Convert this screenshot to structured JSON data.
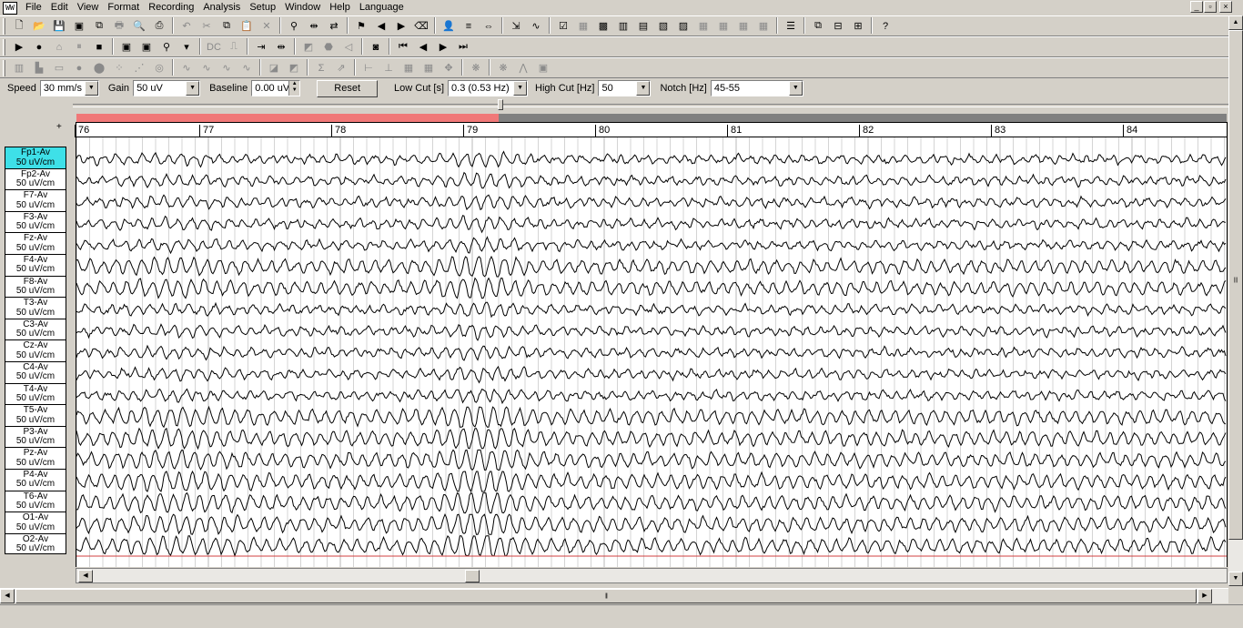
{
  "menu": [
    "File",
    "Edit",
    "View",
    "Format",
    "Recording",
    "Analysis",
    "Setup",
    "Window",
    "Help",
    "Language"
  ],
  "app_icon_text": "WW",
  "window_controls": [
    "_",
    "▫",
    "×"
  ],
  "toolbar1": [
    {
      "icon": "new-file-icon",
      "glyph": "🗋",
      "dim": false
    },
    {
      "icon": "open-folder-icon",
      "glyph": "📂",
      "dim": false
    },
    {
      "icon": "save-icon",
      "glyph": "💾",
      "dim": false
    },
    {
      "icon": "save-as-icon",
      "glyph": "▣",
      "dim": false
    },
    {
      "icon": "copy-icon",
      "glyph": "⧉",
      "dim": false
    },
    {
      "icon": "print-icon",
      "glyph": "🖶",
      "dim": true
    },
    {
      "icon": "print-preview-icon",
      "glyph": "🔍",
      "dim": true
    },
    {
      "icon": "print-setup-icon",
      "glyph": "⎙",
      "dim": false
    },
    {
      "icon": "undo-icon",
      "glyph": "↶",
      "dim": true
    },
    {
      "icon": "cut-icon",
      "glyph": "✂",
      "dim": true
    },
    {
      "icon": "copy2-icon",
      "glyph": "⧉",
      "dim": false
    },
    {
      "icon": "paste-icon",
      "glyph": "📋",
      "dim": false
    },
    {
      "icon": "delete-icon",
      "glyph": "✕",
      "dim": true
    },
    {
      "icon": "find-icon",
      "glyph": "⚲",
      "dim": false
    },
    {
      "icon": "split-icon",
      "glyph": "⇹",
      "dim": false
    },
    {
      "icon": "replace-icon",
      "glyph": "⇄",
      "dim": false
    },
    {
      "icon": "marker-icon",
      "glyph": "⚑",
      "dim": false
    },
    {
      "icon": "marker-prev-icon",
      "glyph": "◀",
      "dim": false
    },
    {
      "icon": "marker-next-icon",
      "glyph": "▶",
      "dim": false
    },
    {
      "icon": "marker-delete-icon",
      "glyph": "⌫",
      "dim": false
    },
    {
      "icon": "patient-icon",
      "glyph": "👤",
      "dim": false
    },
    {
      "icon": "montage-icon",
      "glyph": "≡",
      "dim": false
    },
    {
      "icon": "fit-icon",
      "glyph": "⇔",
      "dim": false
    },
    {
      "icon": "compress-icon",
      "glyph": "⇲",
      "dim": false
    },
    {
      "icon": "filter-icon",
      "glyph": "∿",
      "dim": false
    },
    {
      "icon": "check-icon",
      "glyph": "☑",
      "dim": false
    },
    {
      "icon": "map1-icon",
      "glyph": "▦",
      "dim": true
    },
    {
      "icon": "map2-icon",
      "glyph": "▩",
      "dim": false
    },
    {
      "icon": "map3-icon",
      "glyph": "▥",
      "dim": false
    },
    {
      "icon": "map4-icon",
      "glyph": "▤",
      "dim": false
    },
    {
      "icon": "map5-icon",
      "glyph": "▧",
      "dim": false
    },
    {
      "icon": "map6-icon",
      "glyph": "▨",
      "dim": false
    },
    {
      "icon": "map7-icon",
      "glyph": "▦",
      "dim": true
    },
    {
      "icon": "map8-icon",
      "glyph": "▦",
      "dim": true
    },
    {
      "icon": "map9-icon",
      "glyph": "▦",
      "dim": true
    },
    {
      "icon": "map10-icon",
      "glyph": "▦",
      "dim": true
    },
    {
      "icon": "list-icon",
      "glyph": "☰",
      "dim": false
    },
    {
      "icon": "cascade-icon",
      "glyph": "⧉",
      "dim": false
    },
    {
      "icon": "tile-h-icon",
      "glyph": "⊟",
      "dim": false
    },
    {
      "icon": "tile-v-icon",
      "glyph": "⊞",
      "dim": false
    },
    {
      "icon": "help-icon",
      "glyph": "?",
      "dim": false
    }
  ],
  "toolbar2": [
    {
      "icon": "play-icon",
      "glyph": "▶",
      "dim": false
    },
    {
      "icon": "record-icon",
      "glyph": "●",
      "dim": false
    },
    {
      "icon": "camera-icon",
      "glyph": "⌂",
      "dim": true
    },
    {
      "icon": "pause-icon",
      "glyph": "⏸",
      "dim": true
    },
    {
      "icon": "stop-icon",
      "glyph": "■",
      "dim": false
    },
    {
      "icon": "photo-icon",
      "glyph": "▣",
      "dim": false
    },
    {
      "icon": "photo2-icon",
      "glyph": "▣",
      "dim": false
    },
    {
      "icon": "zoom-icon",
      "glyph": "⚲",
      "dim": false
    },
    {
      "icon": "zoom-dropdown-icon",
      "glyph": "▾",
      "dim": false
    },
    {
      "icon": "dc-icon",
      "glyph": "DC",
      "dim": true
    },
    {
      "icon": "calibrate-icon",
      "glyph": "⎍",
      "dim": true
    },
    {
      "icon": "stim-icon",
      "glyph": "⇥",
      "dim": false
    },
    {
      "icon": "stim2-icon",
      "glyph": "⇹",
      "dim": false
    },
    {
      "icon": "photic-icon",
      "glyph": "◩",
      "dim": true
    },
    {
      "icon": "hyperv-icon",
      "glyph": "⬣",
      "dim": true
    },
    {
      "icon": "sound-icon",
      "glyph": "◁",
      "dim": true
    },
    {
      "icon": "video-icon",
      "glyph": "◙",
      "dim": false
    },
    {
      "icon": "rewind-icon",
      "glyph": "⏮",
      "dim": false
    },
    {
      "icon": "back-icon",
      "glyph": "◀",
      "dim": false
    },
    {
      "icon": "forward-icon",
      "glyph": "▶",
      "dim": false
    },
    {
      "icon": "fast-forward-icon",
      "glyph": "⏭",
      "dim": false
    }
  ],
  "toolbar3": [
    {
      "icon": "bars-icon",
      "glyph": "▥",
      "dim": true
    },
    {
      "icon": "stat-icon",
      "glyph": "▙",
      "dim": true
    },
    {
      "icon": "rect-icon",
      "glyph": "▭",
      "dim": true
    },
    {
      "icon": "circle-icon",
      "glyph": "●",
      "dim": true
    },
    {
      "icon": "blob-icon",
      "glyph": "⬤",
      "dim": true
    },
    {
      "icon": "dots-icon",
      "glyph": "⁘",
      "dim": true
    },
    {
      "icon": "scatter-icon",
      "glyph": "⋰",
      "dim": true
    },
    {
      "icon": "target-icon",
      "glyph": "◎",
      "dim": true
    },
    {
      "icon": "wave1-icon",
      "glyph": "∿",
      "dim": true
    },
    {
      "icon": "wave2-icon",
      "glyph": "∿",
      "dim": true
    },
    {
      "icon": "wave3-icon",
      "glyph": "∿",
      "dim": true
    },
    {
      "icon": "wave4-icon",
      "glyph": "∿",
      "dim": true
    },
    {
      "icon": "slash-box-icon",
      "glyph": "◪",
      "dim": true
    },
    {
      "icon": "slash-box2-icon",
      "glyph": "◩",
      "dim": true
    },
    {
      "icon": "sigma-icon",
      "glyph": "Σ",
      "dim": true
    },
    {
      "icon": "chart-icon",
      "glyph": "⇗",
      "dim": true
    },
    {
      "icon": "cursor-h-icon",
      "glyph": "⊢",
      "dim": true
    },
    {
      "icon": "cursor-v-icon",
      "glyph": "⊥",
      "dim": true
    },
    {
      "icon": "grid1-icon",
      "glyph": "▦",
      "dim": true
    },
    {
      "icon": "grid2-icon",
      "glyph": "▦",
      "dim": true
    },
    {
      "icon": "move-icon",
      "glyph": "✥",
      "dim": true
    },
    {
      "icon": "brain-icon",
      "glyph": "❋",
      "dim": true
    },
    {
      "icon": "brain2-icon",
      "glyph": "❋",
      "dim": true
    },
    {
      "icon": "spike-icon",
      "glyph": "⋀",
      "dim": true
    },
    {
      "icon": "export-icon",
      "glyph": "▣",
      "dim": true
    }
  ],
  "settings": {
    "speed_label": "Speed",
    "speed_value": "30 mm/s",
    "gain_label": "Gain",
    "gain_value": "50 uV",
    "baseline_label": "Baseline",
    "baseline_value": "0.00 uV",
    "reset_label": "Reset",
    "lowcut_label": "Low Cut [s]",
    "lowcut_value": "0.3   (0.53 Hz)",
    "highcut_label": "High Cut [Hz]",
    "highcut_value": "50",
    "notch_label": "Notch [Hz]",
    "notch_value": "45-55"
  },
  "playback_progress": 0.367,
  "time_ruler": [
    "76",
    "77",
    "78",
    "79",
    "80",
    "81",
    "82",
    "83",
    "84"
  ],
  "channel_panel_plus": "+",
  "channels": [
    {
      "name": "Fp1-Av",
      "scale": "50 uV/cm",
      "selected": true
    },
    {
      "name": "Fp2-Av",
      "scale": "50 uV/cm",
      "selected": false
    },
    {
      "name": "F7-Av",
      "scale": "50 uV/cm",
      "selected": false
    },
    {
      "name": "F3-Av",
      "scale": "50 uV/cm",
      "selected": false
    },
    {
      "name": "Fz-Av",
      "scale": "50 uV/cm",
      "selected": false
    },
    {
      "name": "F4-Av",
      "scale": "50 uV/cm",
      "selected": false
    },
    {
      "name": "F8-Av",
      "scale": "50 uV/cm",
      "selected": false
    },
    {
      "name": "T3-Av",
      "scale": "50 uV/cm",
      "selected": false
    },
    {
      "name": "C3-Av",
      "scale": "50 uV/cm",
      "selected": false
    },
    {
      "name": "Cz-Av",
      "scale": "50 uV/cm",
      "selected": false
    },
    {
      "name": "C4-Av",
      "scale": "50 uV/cm",
      "selected": false
    },
    {
      "name": "T4-Av",
      "scale": "50 uV/cm",
      "selected": false
    },
    {
      "name": "T5-Av",
      "scale": "50 uV/cm",
      "selected": false
    },
    {
      "name": "P3-Av",
      "scale": "50 uV/cm",
      "selected": false
    },
    {
      "name": "Pz-Av",
      "scale": "50 uV/cm",
      "selected": false
    },
    {
      "name": "P4-Av",
      "scale": "50 uV/cm",
      "selected": false
    },
    {
      "name": "T6-Av",
      "scale": "50 uV/cm",
      "selected": false
    },
    {
      "name": "O1-Av",
      "scale": "50 uV/cm",
      "selected": false
    },
    {
      "name": "O2-Av",
      "scale": "50 uV/cm",
      "selected": false
    }
  ],
  "colors": {
    "trace": "#000000",
    "grid": "#b8b8b8",
    "selected_channel": "#3ee0e8",
    "progress_fill": "#f07878",
    "red_line": "#d04040"
  },
  "scroll_labels": {
    "left_arrow": "◀",
    "right_arrow": "▶",
    "up_arrow": "▲",
    "down_arrow": "▼",
    "thumb_grip": "|||"
  }
}
